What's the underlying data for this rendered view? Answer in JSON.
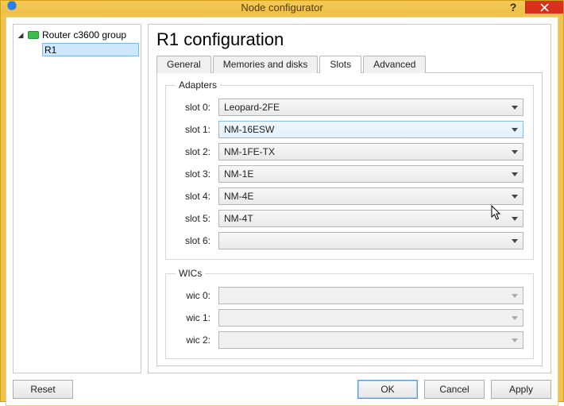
{
  "window": {
    "title": "Node configurator"
  },
  "tree": {
    "root_label": "Router c3600 group",
    "child_label": "R1"
  },
  "header": {
    "title": "R1 configuration"
  },
  "tabs": {
    "general": "General",
    "memories": "Memories and disks",
    "slots": "Slots",
    "advanced": "Advanced",
    "active": "slots"
  },
  "adapters_group_label": "Adapters",
  "adapters": [
    {
      "label": "slot 0:",
      "value": "Leopard-2FE",
      "disabled": false,
      "hover": false
    },
    {
      "label": "slot 1:",
      "value": "NM-16ESW",
      "disabled": false,
      "hover": true
    },
    {
      "label": "slot 2:",
      "value": "NM-1FE-TX",
      "disabled": false,
      "hover": false
    },
    {
      "label": "slot 3:",
      "value": "NM-1E",
      "disabled": false,
      "hover": false
    },
    {
      "label": "slot 4:",
      "value": "NM-4E",
      "disabled": false,
      "hover": false
    },
    {
      "label": "slot 5:",
      "value": "NM-4T",
      "disabled": false,
      "hover": false
    },
    {
      "label": "slot 6:",
      "value": "",
      "disabled": false,
      "hover": false
    }
  ],
  "wics_group_label": "WICs",
  "wics": [
    {
      "label": "wic 0:",
      "value": "",
      "disabled": true
    },
    {
      "label": "wic 1:",
      "value": "",
      "disabled": true
    },
    {
      "label": "wic 2:",
      "value": "",
      "disabled": true
    }
  ],
  "buttons": {
    "reset": "Reset",
    "ok": "OK",
    "cancel": "Cancel",
    "apply": "Apply"
  }
}
